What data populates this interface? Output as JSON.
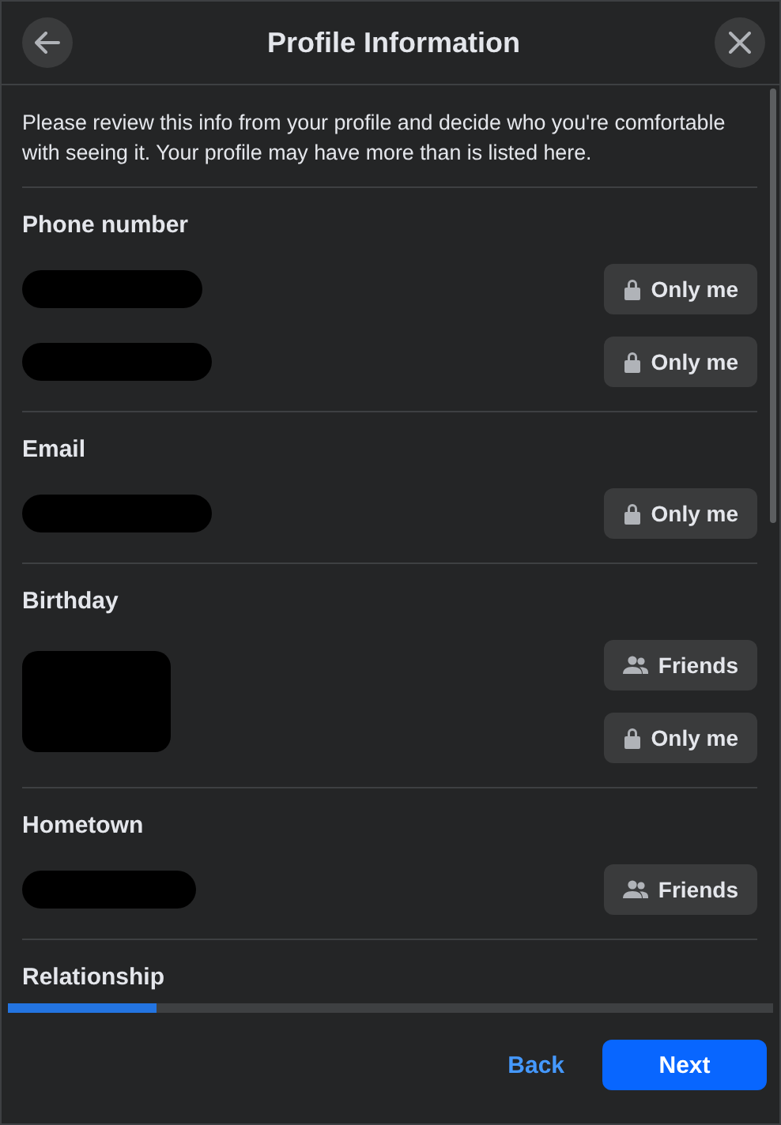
{
  "header": {
    "title": "Profile Information"
  },
  "intro": "Please review this info from your profile and decide who you're comfortable with seeing it. Your profile may have more than is listed here.",
  "sections": [
    {
      "title": "Phone number",
      "redactions": [
        {
          "kind": "line"
        },
        {
          "kind": "line"
        }
      ],
      "audiences": [
        {
          "label": "Only me",
          "kind": "lock"
        },
        {
          "label": "Only me",
          "kind": "lock"
        }
      ]
    },
    {
      "title": "Email",
      "redactions": [
        {
          "kind": "line"
        }
      ],
      "audiences": [
        {
          "label": "Only me",
          "kind": "lock"
        }
      ]
    },
    {
      "title": "Birthday",
      "redactions": [
        {
          "kind": "block"
        }
      ],
      "audiences": [
        {
          "label": "Friends",
          "kind": "people"
        },
        {
          "label": "Only me",
          "kind": "lock"
        }
      ]
    },
    {
      "title": "Hometown",
      "redactions": [
        {
          "kind": "line"
        }
      ],
      "audiences": [
        {
          "label": "Friends",
          "kind": "people"
        }
      ]
    },
    {
      "title": "Relationship"
    }
  ],
  "progress": {
    "level": 0.195
  },
  "footer": {
    "back": "Back",
    "next": "Next"
  }
}
